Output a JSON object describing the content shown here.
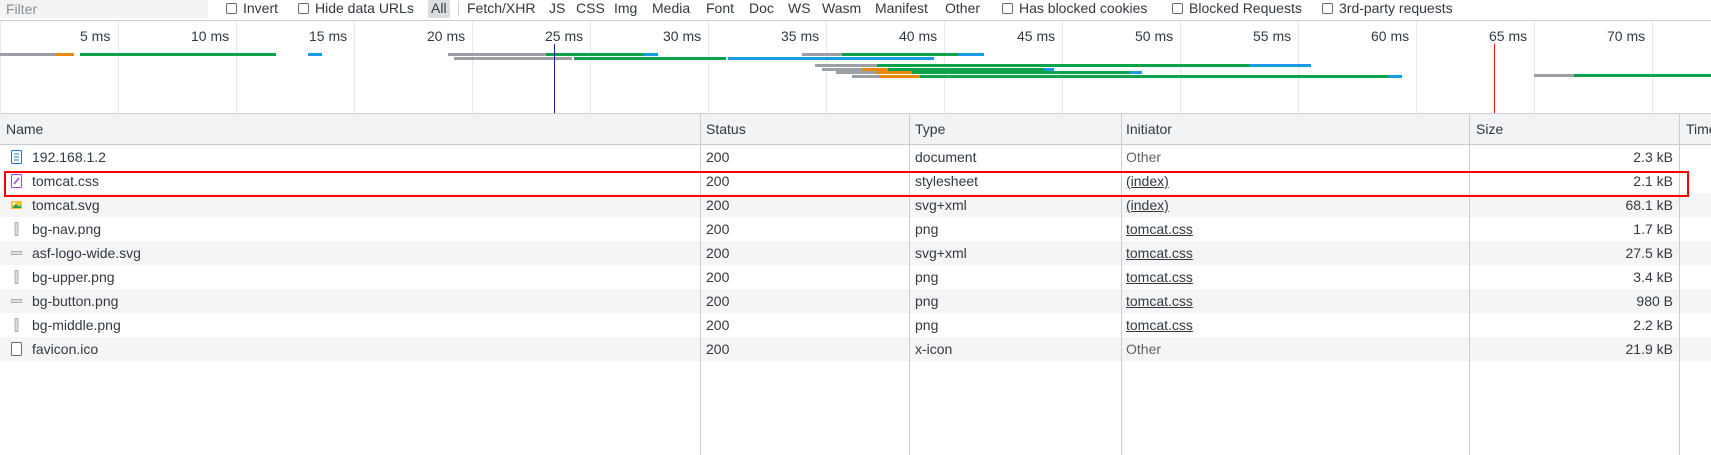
{
  "filter": {
    "placeholder": "Filter"
  },
  "toolbar": {
    "invert_label": "Invert",
    "hide_data_urls_label": "Hide data URLs",
    "type_filters": [
      "All",
      "Fetch/XHR",
      "JS",
      "CSS",
      "Img",
      "Media",
      "Font",
      "Doc",
      "WS",
      "Wasm",
      "Manifest",
      "Other"
    ],
    "active_type": "All",
    "has_blocked_cookies_label": "Has blocked cookies",
    "blocked_requests_label": "Blocked Requests",
    "third_party_label": "3rd-party requests"
  },
  "overview": {
    "tick_labels": [
      "5 ms",
      "10 ms",
      "15 ms",
      "20 ms",
      "25 ms",
      "30 ms",
      "35 ms",
      "40 ms",
      "45 ms",
      "50 ms",
      "55 ms",
      "60 ms",
      "65 ms",
      "70 ms"
    ],
    "colors": {
      "waiting": "#9aa0a6",
      "queue": "#e8890c",
      "ttfb": "#0da34a",
      "download": "#1a9be6",
      "dom_marker": "#1a1a9a",
      "load_marker": "#e81212"
    }
  },
  "table": {
    "columns": {
      "name": "Name",
      "status": "Status",
      "type": "Type",
      "initiator": "Initiator",
      "size": "Size",
      "time": "Time"
    },
    "rows": [
      {
        "name": "192.168.1.2",
        "icon": "document-icon",
        "status": "200",
        "type": "document",
        "initiator": "Other",
        "initiator_link": false,
        "size": "2.3 kB"
      },
      {
        "name": "tomcat.css",
        "icon": "stylesheet-icon",
        "status": "200",
        "type": "stylesheet",
        "initiator": "(index)",
        "initiator_link": true,
        "size": "2.1 kB"
      },
      {
        "name": "tomcat.svg",
        "icon": "image-icon",
        "status": "200",
        "type": "svg+xml",
        "initiator": "(index)",
        "initiator_link": true,
        "size": "68.1 kB"
      },
      {
        "name": "bg-nav.png",
        "icon": "image-thin-icon",
        "status": "200",
        "type": "png",
        "initiator": "tomcat.css",
        "initiator_link": true,
        "size": "1.7 kB"
      },
      {
        "name": "asf-logo-wide.svg",
        "icon": "image-wide-icon",
        "status": "200",
        "type": "svg+xml",
        "initiator": "tomcat.css",
        "initiator_link": true,
        "size": "27.5 kB"
      },
      {
        "name": "bg-upper.png",
        "icon": "image-thin-icon",
        "status": "200",
        "type": "png",
        "initiator": "tomcat.css",
        "initiator_link": true,
        "size": "3.4 kB"
      },
      {
        "name": "bg-button.png",
        "icon": "image-wide-icon",
        "status": "200",
        "type": "png",
        "initiator": "tomcat.css",
        "initiator_link": true,
        "size": "980 B"
      },
      {
        "name": "bg-middle.png",
        "icon": "image-thin-icon",
        "status": "200",
        "type": "png",
        "initiator": "tomcat.css",
        "initiator_link": true,
        "size": "2.2 kB"
      },
      {
        "name": "favicon.ico",
        "icon": "file-icon",
        "status": "200",
        "type": "x-icon",
        "initiator": "Other",
        "initiator_link": false,
        "size": "21.9 kB"
      }
    ]
  }
}
